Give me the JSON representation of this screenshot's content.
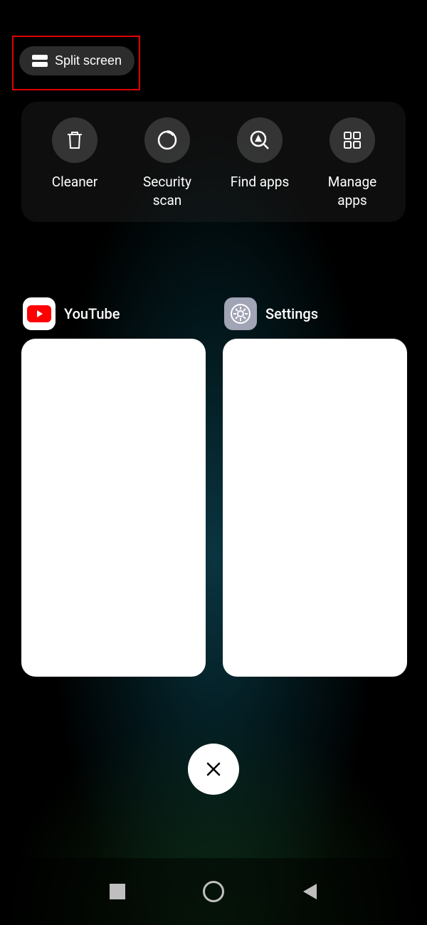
{
  "split_screen": {
    "label": "Split screen"
  },
  "tools": {
    "cleaner": {
      "label": "Cleaner"
    },
    "security": {
      "label": "Security\nscan"
    },
    "find": {
      "label": "Find apps"
    },
    "manage": {
      "label": "Manage\napps"
    }
  },
  "apps": {
    "youtube": {
      "title": "YouTube"
    },
    "settings": {
      "title": "Settings"
    }
  }
}
